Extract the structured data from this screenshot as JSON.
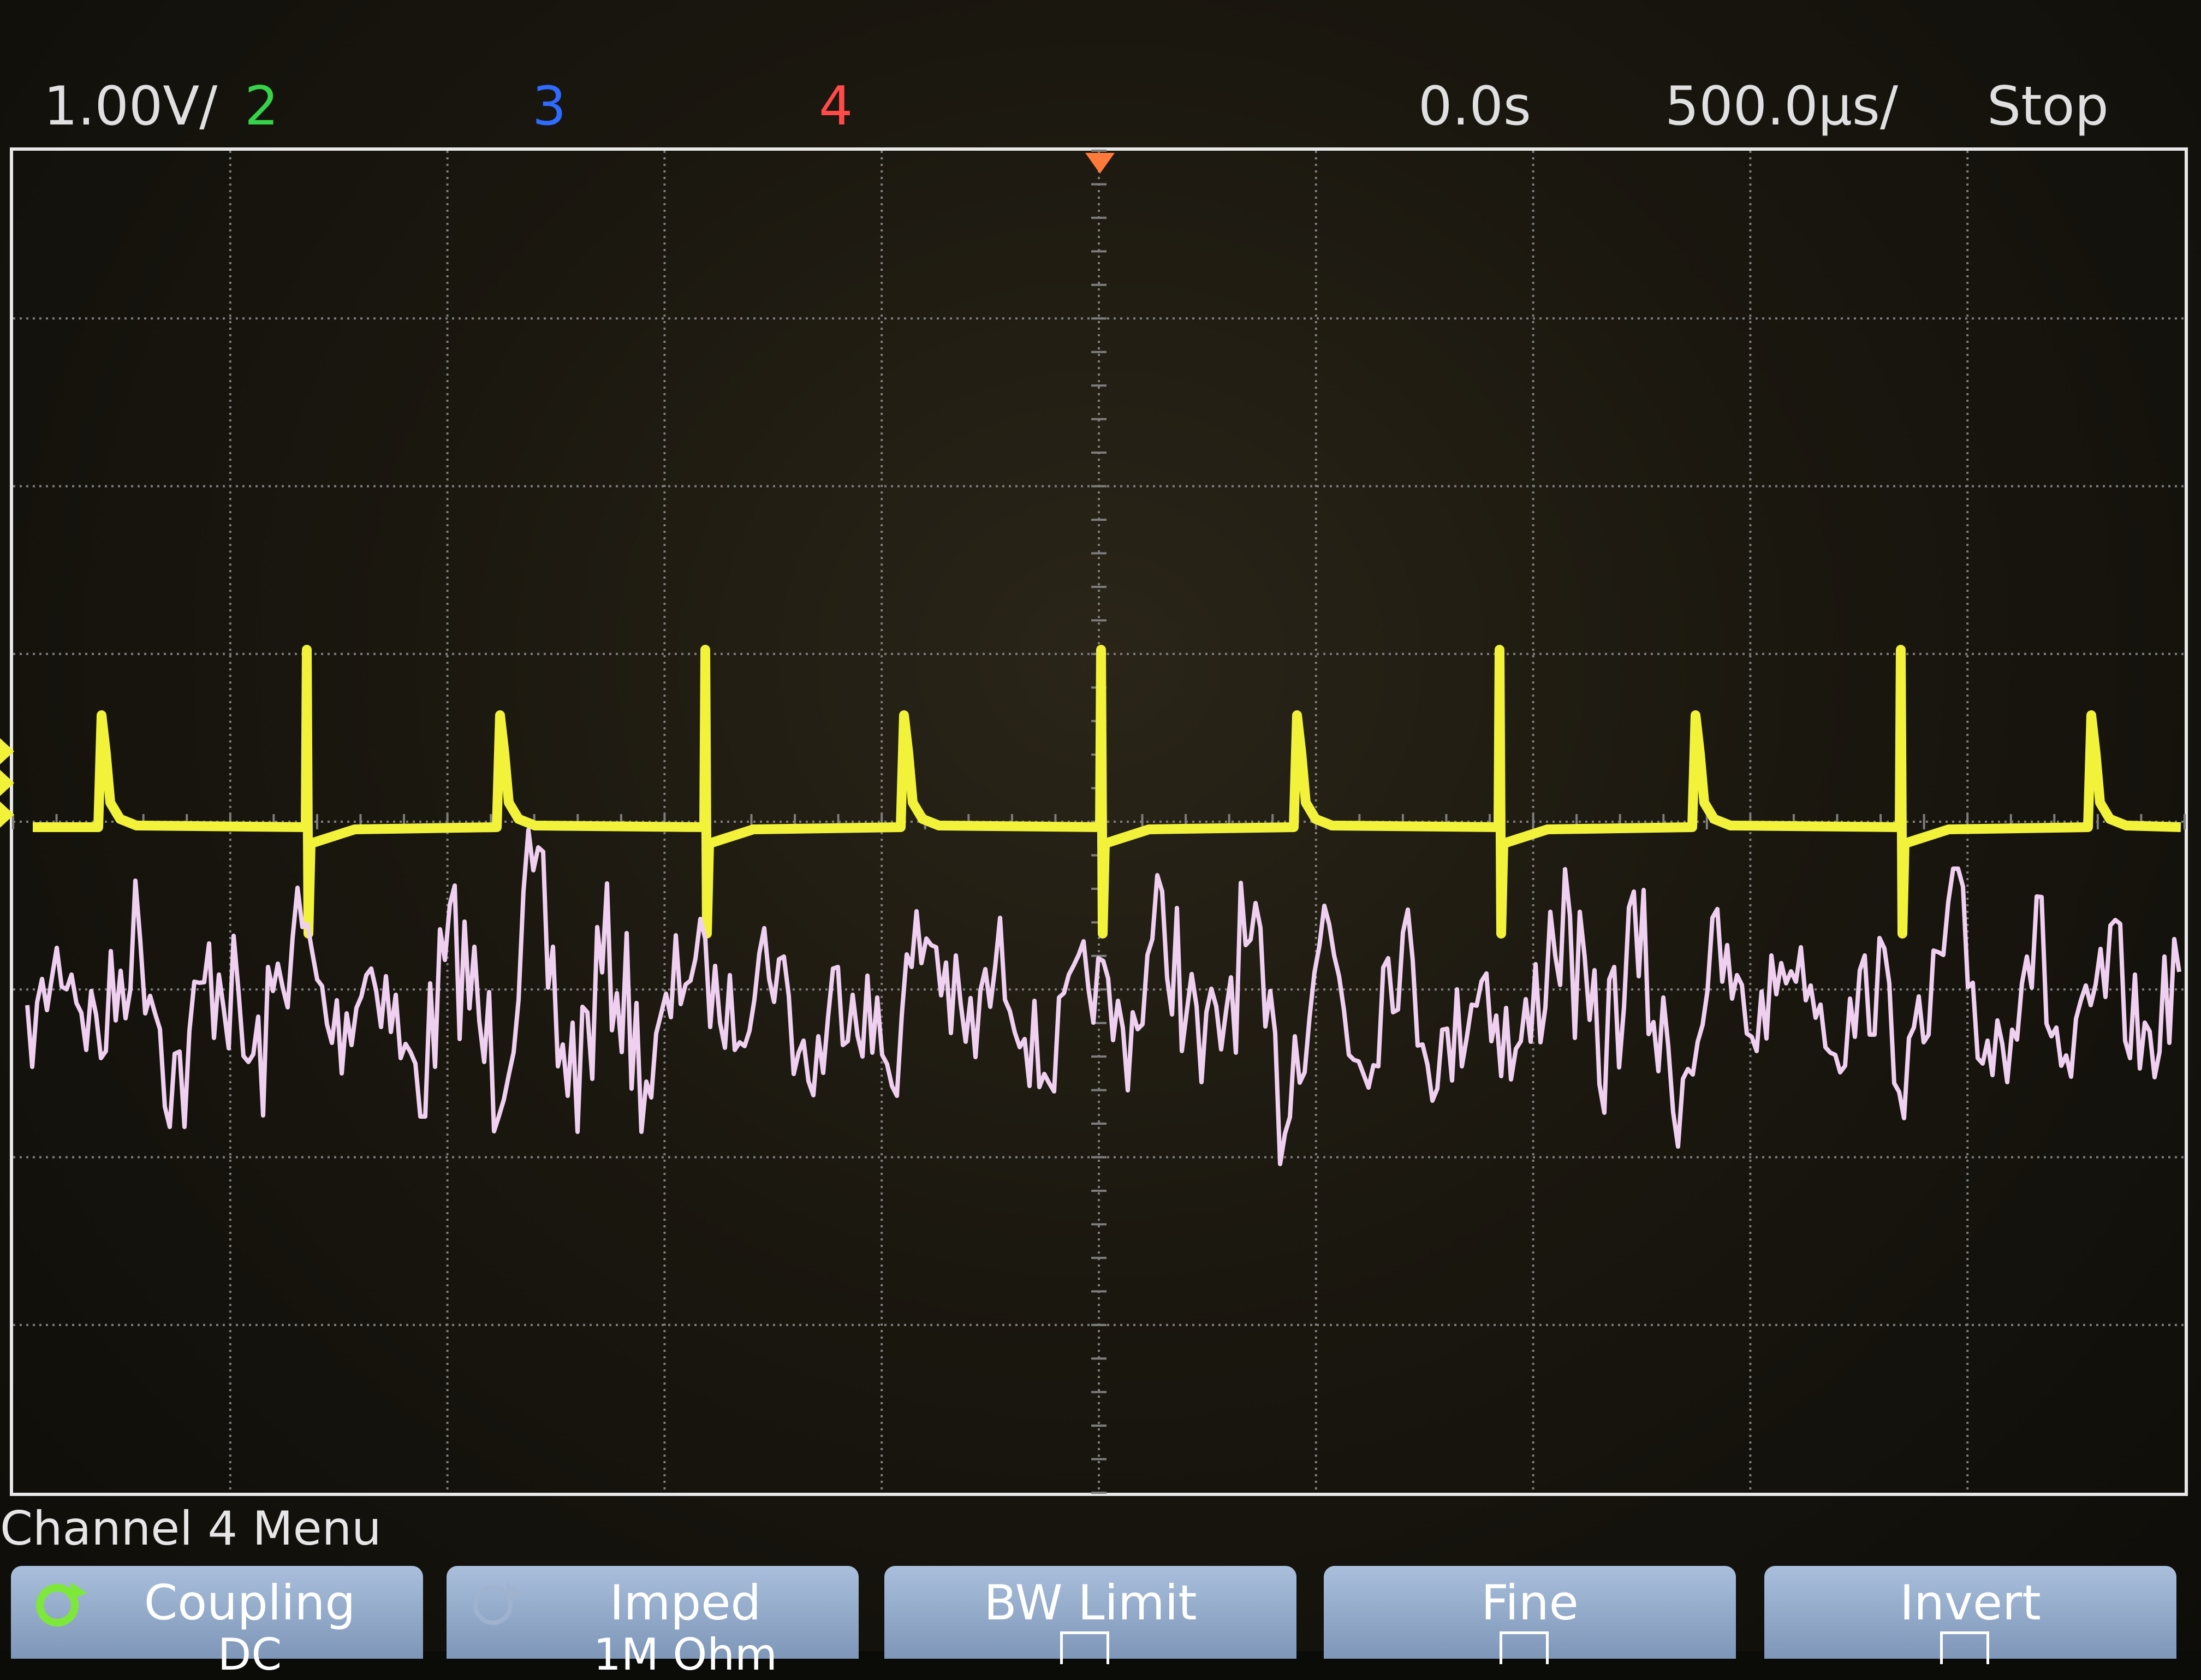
{
  "status_bar": {
    "volts_per_div": "1.00V/",
    "channel_2_label": "2",
    "channel_3_label": "3",
    "channel_4_label": "4",
    "time_delay": "0.0s",
    "time_per_div": "500.0µs/",
    "run_state": "Stop"
  },
  "colors": {
    "channel_1": "#f2f23a",
    "channel_2": "#36d24a",
    "channel_3": "#2f6bff",
    "channel_4": "#ff4a4a",
    "math_trace": "#f0d0f0",
    "status_text": "#e0e0e0",
    "grid": "#8a8a8a",
    "trigger_marker": "#ff7a3a"
  },
  "menu": {
    "title": "Channel 4 Menu",
    "softkeys": [
      {
        "label": "Coupling",
        "value": "DC",
        "icon": "entry-knob-icon"
      },
      {
        "label": "Imped",
        "value": "1M Ohm",
        "icon": "entry-knob-icon"
      },
      {
        "label": "BW Limit",
        "value": ""
      },
      {
        "label": "Fine",
        "value": ""
      },
      {
        "label": "Invert",
        "value": ""
      }
    ]
  }
}
